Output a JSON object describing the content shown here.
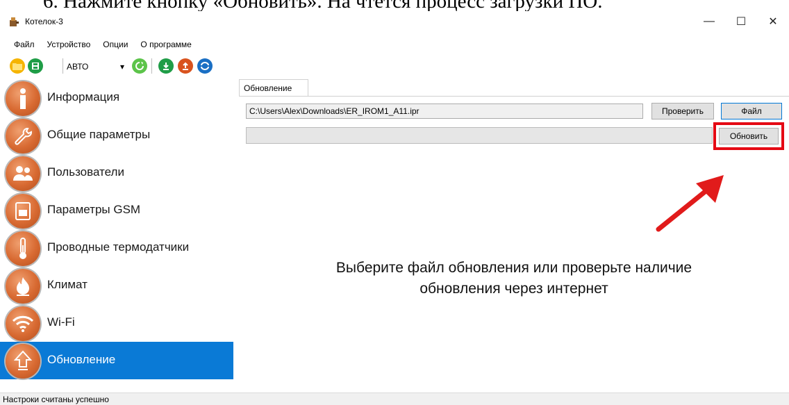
{
  "document": {
    "instruction": "6. Нажмите кнопку «Обновить». На чтется процесс загрузки ПО."
  },
  "window": {
    "title": "Котелок-3",
    "minimize_glyph": "—",
    "maximize_glyph": "☐",
    "close_glyph": "✕"
  },
  "menu": {
    "items": [
      "Файл",
      "Устройство",
      "Опции",
      "О программе"
    ]
  },
  "toolbar": {
    "mode_value": "АВТО",
    "mode_arrow": "▾",
    "icons": [
      "folder-icon",
      "save-icon",
      "refresh-icon",
      "download-icon",
      "upload-icon",
      "sync-icon"
    ]
  },
  "sidebar": {
    "items": [
      {
        "label": "Информация",
        "icon": "info-icon",
        "glyph": "i"
      },
      {
        "label": "Общие параметры",
        "icon": "wrench-icon",
        "glyph": "🔧"
      },
      {
        "label": "Пользователи",
        "icon": "users-icon",
        "glyph": "👥"
      },
      {
        "label": "Параметры GSM",
        "icon": "sim-card-icon",
        "glyph": "▤"
      },
      {
        "label": "Проводные термодатчики",
        "icon": "thermometer-icon",
        "glyph": "🌡"
      },
      {
        "label": "Климат",
        "icon": "flame-icon",
        "glyph": "🔥"
      },
      {
        "label": "Wi-Fi",
        "icon": "wifi-icon",
        "glyph": "◠"
      },
      {
        "label": "Обновление",
        "icon": "arrow-up-icon",
        "glyph": "⇧",
        "active": true
      }
    ]
  },
  "update_panel": {
    "tab_label": "Обновление",
    "file_path": "C:\\Users\\Alex\\Downloads\\ER_IROM1_A11.ipr",
    "check_button": "Проверить",
    "file_button": "Файл",
    "update_button": "Обновить",
    "progress": 0,
    "message_line1": "Выберите файл обновления или проверьте наличие",
    "message_line2": "обновления через интернет"
  },
  "status": {
    "text": "Настроки считаны успешно"
  },
  "colors": {
    "accent": "#0a7ad6",
    "highlight": "#e50914",
    "sidebar_icon": "#d86a32"
  }
}
